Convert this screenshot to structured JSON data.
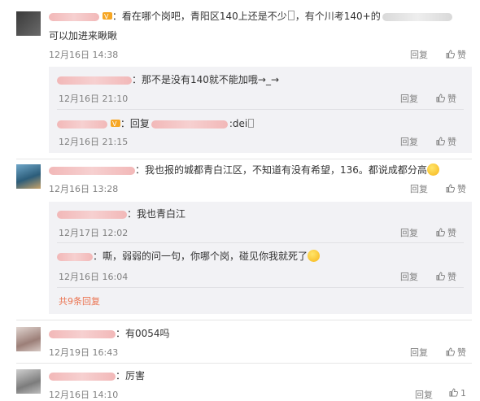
{
  "comments": [
    {
      "text_line1": "：看在哪个岗吧，青阳区140上还是不少",
      "text_line1b": "，有个川考140+的",
      "text_line2": "可以加进来瞅瞅",
      "time": "12月16日 14:38",
      "reply_label": "回复",
      "like_label": "赞",
      "replies": [
        {
          "text": "：那不是没有140就不能加哦→_→",
          "time": "12月16日 21:10",
          "reply_label": "回复",
          "like_label": "赞"
        },
        {
          "text_prefix": "：回复",
          "text_suffix": ":dei",
          "time": "12月16日 21:15",
          "reply_label": "回复",
          "like_label": "赞"
        }
      ]
    },
    {
      "text": "：我也报的城都青白江区，不知道有没有希望，136。都说成都分高",
      "time": "12月16日 13:28",
      "reply_label": "回复",
      "like_label": "赞",
      "replies": [
        {
          "text": "：我也青白江",
          "time": "12月17日 12:02",
          "reply_label": "回复",
          "like_label": "赞"
        },
        {
          "text": "：嘶，弱弱的问一句，你哪个岗，碰见你我就死了",
          "time": "12月16日 16:04",
          "reply_label": "回复",
          "like_label": "赞"
        }
      ],
      "more_replies": "共9条回复"
    },
    {
      "text": "：有0054吗",
      "time": "12月19日 16:43",
      "reply_label": "回复",
      "like_label": "赞"
    },
    {
      "text": "：厉害",
      "time": "12月16日 14:10",
      "reply_label": "回复",
      "like_count": "1"
    }
  ]
}
